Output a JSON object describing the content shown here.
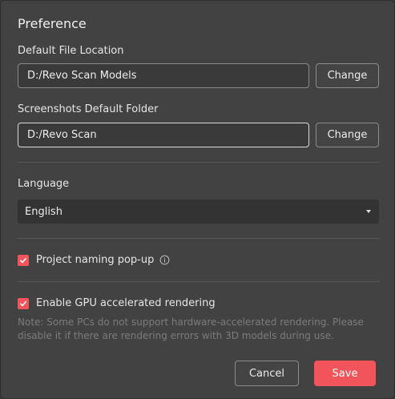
{
  "dialog": {
    "title": "Preference"
  },
  "file_location": {
    "label": "Default File Location",
    "value": "D:/Revo Scan Models",
    "button_label": "Change"
  },
  "screenshots_folder": {
    "label": "Screenshots Default Folder",
    "value": "D:/Revo Scan",
    "button_label": "Change"
  },
  "language": {
    "label": "Language",
    "selected": "English",
    "dropdown_icon": "caret-down-icon"
  },
  "project_naming": {
    "label": "Project naming pop-up",
    "checked": true,
    "info_icon": "info-icon"
  },
  "gpu_rendering": {
    "label": "Enable GPU accelerated rendering",
    "checked": true,
    "note": "Note: Some PCs do not support hardware-accelerated rendering. Please disable it if there are rendering errors with 3D models during use."
  },
  "footer": {
    "cancel_label": "Cancel",
    "save_label": "Save"
  },
  "colors": {
    "background": "#424242",
    "accent": "#f2545b",
    "input_background": "#333333",
    "note_text": "#7c7c7c"
  }
}
